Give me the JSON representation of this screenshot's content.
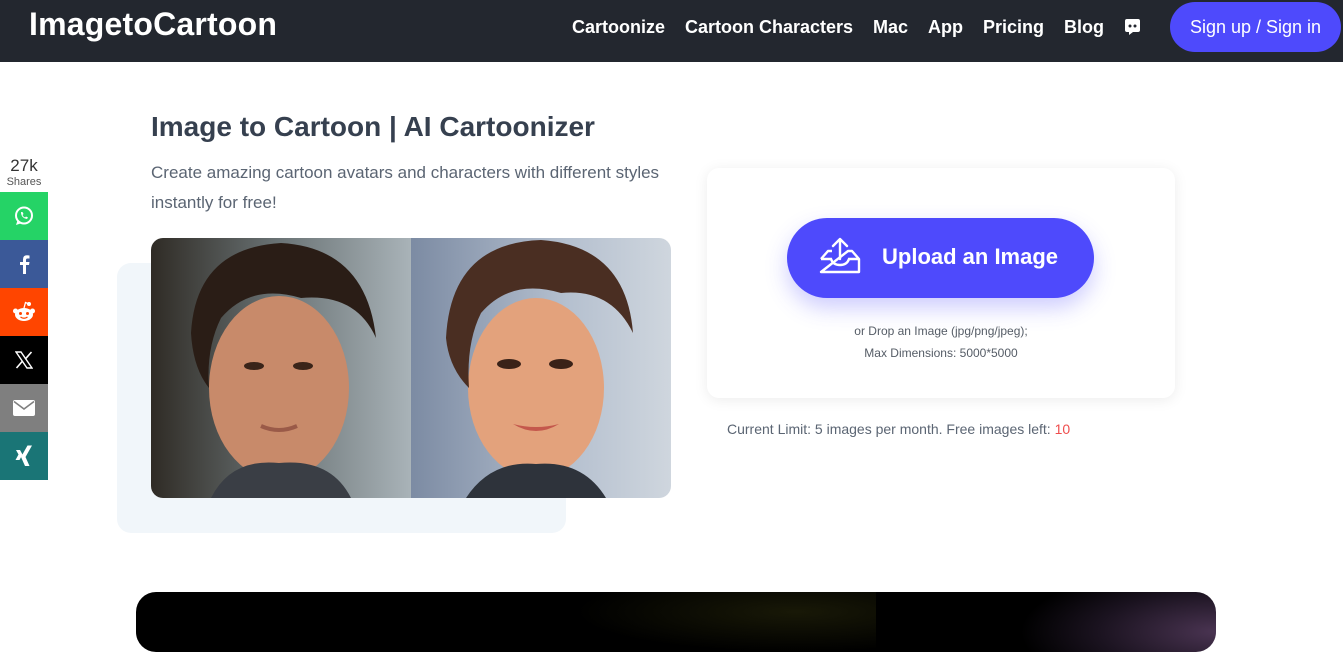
{
  "header": {
    "logo": "ImagetoCartoon",
    "nav": [
      {
        "label": "Cartoonize"
      },
      {
        "label": "Cartoon Characters"
      },
      {
        "label": "Mac"
      },
      {
        "label": "App"
      },
      {
        "label": "Pricing"
      },
      {
        "label": "Blog"
      }
    ],
    "discord_icon": "discord-icon",
    "signin_label": "Sign up / Sign in"
  },
  "share": {
    "count": "27k",
    "label": "Shares",
    "networks": [
      {
        "name": "whatsapp",
        "icon": "whatsapp-icon",
        "color": "#25d366"
      },
      {
        "name": "facebook",
        "icon": "facebook-icon",
        "color": "#3b5998"
      },
      {
        "name": "reddit",
        "icon": "reddit-icon",
        "color": "#ff4500"
      },
      {
        "name": "x",
        "icon": "x-icon",
        "color": "#000000"
      },
      {
        "name": "email",
        "icon": "email-icon",
        "color": "#7f7f7f"
      },
      {
        "name": "xing",
        "icon": "xing-icon",
        "color": "#1a7576"
      }
    ]
  },
  "hero": {
    "title": "Image to Cartoon | AI Cartoonizer",
    "subtitle": "Create amazing cartoon avatars and characters with different styles instantly for free!"
  },
  "upload": {
    "button_label": "Upload an Image",
    "icon": "upload-tray-icon",
    "drop_note": "or Drop an Image (jpg/png/jpeg);",
    "max_dimensions": "Max Dimensions: 5000*5000",
    "limit_text": "Current Limit: 5 images per month. Free images left: ",
    "free_left": "10"
  },
  "colors": {
    "header_bg": "#23272f",
    "accent": "#4e4afc",
    "highlight_red": "#ef4d4d"
  }
}
